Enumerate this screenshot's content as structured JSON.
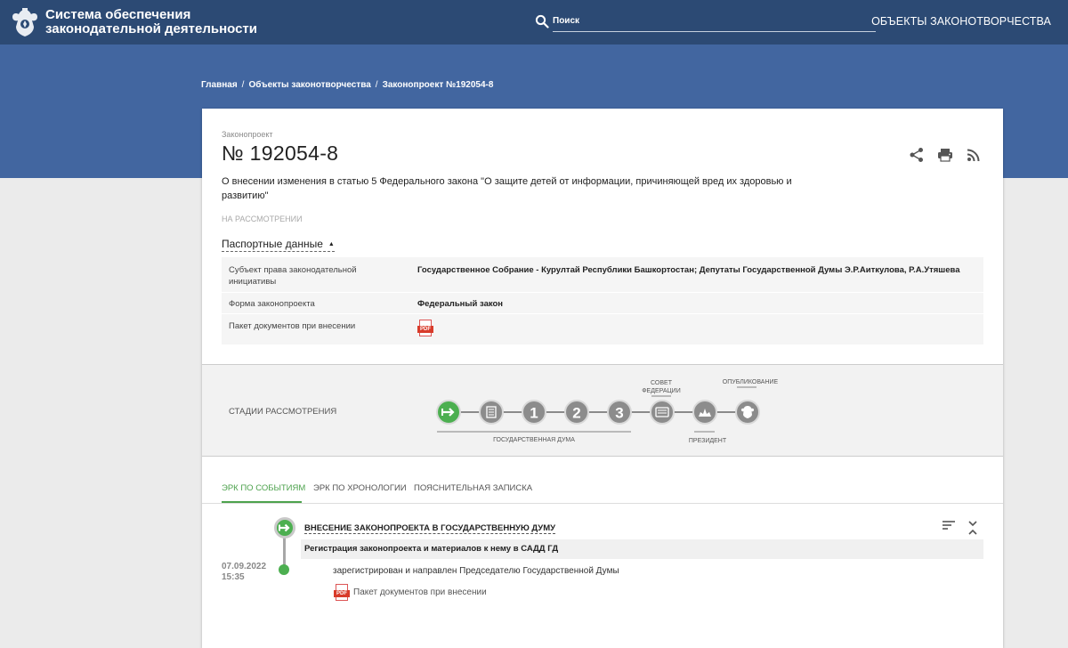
{
  "header": {
    "site_title_line1": "Система обеспечения",
    "site_title_line2": "законодательной деятельности",
    "search_label": "Поиск",
    "nav_link": "ОБЪЕКТЫ ЗАКОНОТВОРЧЕСТВА"
  },
  "breadcrumb": [
    "Главная",
    "Объекты законотворчества",
    "Законопроект №192054-8"
  ],
  "bill": {
    "kind": "Законопроект",
    "number": "№ 192054-8",
    "title": "О внесении изменения в статью 5 Федерального закона \"О защите детей от информации, причиняющей вред их здоровью и развитию\"",
    "status": "НА РАССМОТРЕНИИ",
    "actions": [
      "share-icon",
      "print-icon",
      "rss-icon"
    ]
  },
  "passport": {
    "toggle_label": "Паспортные данные",
    "rows": [
      {
        "key": "Субъект права законодательной инициативы",
        "value": "Государственное Собрание - Курултай Республики Башкортостан; Депутаты Государственной Думы Э.Р.Аиткулова, Р.А.Утяшева"
      },
      {
        "key": "Форма законопроекта",
        "value": "Федеральный закон"
      },
      {
        "key": "Пакет документов при внесении",
        "value": "",
        "pdf_label": "PDF"
      }
    ]
  },
  "stages": {
    "label": "СТАДИИ РАССМОТРЕНИЯ",
    "steps": [
      "1",
      "2",
      "3"
    ],
    "group_duma": "ГОСУДАРСТВЕННАЯ ДУМА",
    "council_line1": "СОВЕТ",
    "council_line2": "ФЕДЕРАЦИИ",
    "president": "ПРЕЗИДЕНТ",
    "publication": "ОПУБЛИКОВАНИЕ",
    "current_stage": 1,
    "accent_color": "#4caf50"
  },
  "tabs": [
    "ЭРК ПО СОБЫТИЯМ",
    "ЭРК ПО ХРОНОЛОГИИ",
    "ПОЯСНИТЕЛЬНАЯ ЗАПИСКА"
  ],
  "event": {
    "title": "ВНЕСЕНИЕ ЗАКОНОПРОЕКТА В ГОСУДАРСТВЕННУЮ ДУМУ",
    "subtitle": "Регистрация законопроекта и материалов к нему в САДД ГД",
    "date": "07.09.2022",
    "time": "15:35",
    "text": "зарегистрирован и направлен Председателю Государственной Думы",
    "doc_label": "Пакет документов при внесении",
    "pdf_label": "PDF"
  }
}
